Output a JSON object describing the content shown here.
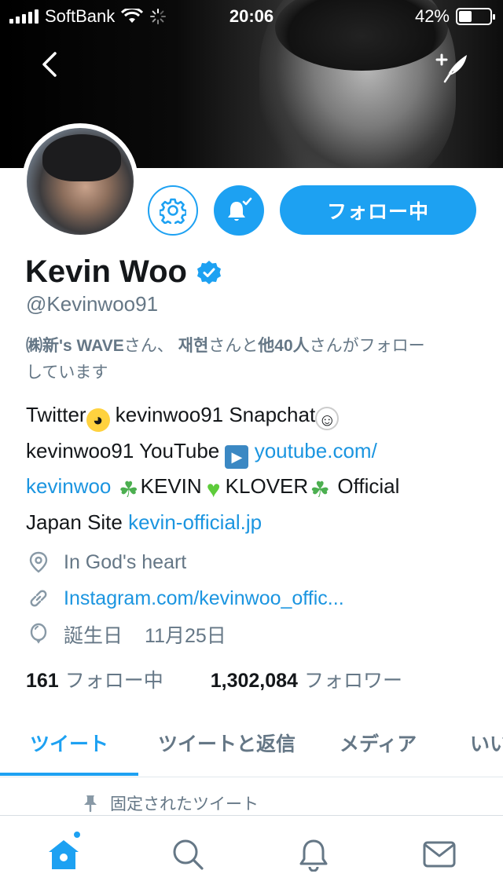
{
  "status_bar": {
    "carrier": "SoftBank",
    "time": "20:06",
    "battery_percent": "42%",
    "battery_level": 0.42
  },
  "header": {
    "back_icon": "chevron-left-icon",
    "compose_icon": "compose-tweet-icon"
  },
  "profile": {
    "name": "Kevin Woo",
    "verified": true,
    "handle": "@Kevinwoo91",
    "follow_button_label": "フォロー中",
    "followed_by": {
      "name1": "㈱新's WAVE",
      "sep1": "さん、 ",
      "name2": "재현",
      "sep2": "さんと",
      "others": "他40人",
      "suffix": "さんがフォロー",
      "line2": "しています"
    },
    "bio": {
      "t1": "Twitter",
      "t2": " kevinwoo91 Snapchat",
      "t3": "kevinwoo91 YouTube ",
      "link1a": "youtube.com/",
      "link1b": "kevinwoo",
      "t4": "KEVIN",
      "t5": "KLOVER",
      "t6": " Official",
      "t7": "Japan Site ",
      "link2": "kevin-official.jp"
    },
    "location": "In God's heart",
    "website": "Instagram.com/kevinwoo_offic...",
    "birthday_label": "誕生日",
    "birthday": "11月25日",
    "following_count": "161",
    "following_label": "フォロー中",
    "followers_count": "1,302,084",
    "followers_label": "フォロワー"
  },
  "tabs": [
    {
      "label": "ツイート",
      "active": true
    },
    {
      "label": "ツイートと返信",
      "active": false
    },
    {
      "label": "メディア",
      "active": false
    },
    {
      "label": "いい",
      "active": false
    }
  ],
  "pinned_label": "固定されたツイート",
  "colors": {
    "accent": "#1da1f2",
    "link": "#1b95e0",
    "secondary_text": "#657786"
  },
  "bottom_nav": [
    "home-icon",
    "search-icon",
    "notifications-icon",
    "messages-icon"
  ]
}
